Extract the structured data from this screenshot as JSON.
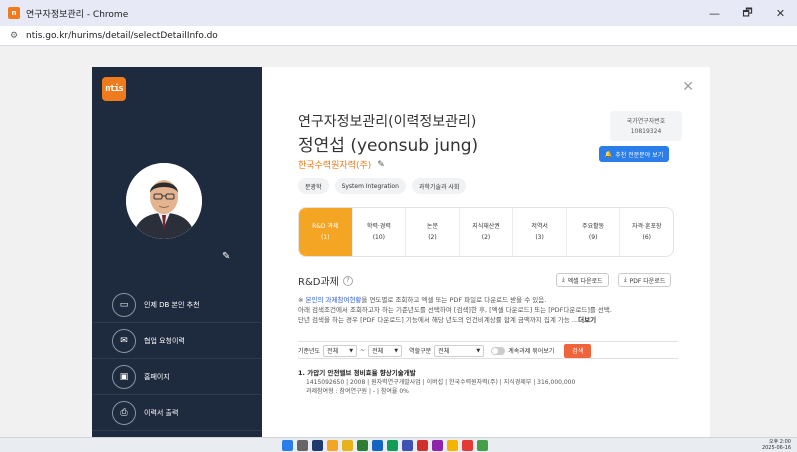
{
  "window": {
    "title": "연구자정보관리 - Chrome",
    "controls": [
      "—",
      "🗗",
      "✕"
    ]
  },
  "address": {
    "url": "ntis.go.kr/hurims/detail/selectDetailInfo.do"
  },
  "sidebar": {
    "logo_text": "ntis",
    "menu": [
      {
        "label": "인제 DB 본인 추천",
        "icon": "id-card-icon"
      },
      {
        "label": "협업 요청이력",
        "icon": "mail-icon"
      },
      {
        "label": "홈페이지",
        "icon": "monitor-icon"
      },
      {
        "label": "이력서 출력",
        "icon": "printer-icon"
      }
    ]
  },
  "profile": {
    "title": "연구자정보관리(이력정보관리)",
    "name": "정연섭 (yeonsub jung)",
    "org": "한국수력원자력(주)",
    "id_label": "국가연구자번호",
    "id_value": "10819324",
    "expert_button": "추천 전문분야 보기",
    "tags": [
      "분광학",
      "System Integration",
      "과학기술과 사회"
    ]
  },
  "tabs": [
    {
      "label": "R&D 과제",
      "count": "(1)",
      "active": true
    },
    {
      "label": "학력·경력",
      "count": "(10)",
      "active": false
    },
    {
      "label": "논문",
      "count": "(2)",
      "active": false
    },
    {
      "label": "지식재산권",
      "count": "(2)",
      "active": false
    },
    {
      "label": "저역서",
      "count": "(3)",
      "active": false
    },
    {
      "label": "주요활동",
      "count": "(9)",
      "active": false
    },
    {
      "label": "자격·훈포장",
      "count": "(6)",
      "active": false
    }
  ],
  "section": {
    "title": "R&D과제",
    "excel_button": "엑셀 다운로드",
    "pdf_button": "PDF 다운로드",
    "notice_prefix": "※ ",
    "notice_highlight": "본인의 과제참여현황",
    "notice_line1_rest": "을 연도별로 조회하고 엑셀 또는 PDF 파일로 다운로드 받을 수 있음.",
    "notice_line2": "아래 검색조건에서 조회하고자 하는 기준년도를 선택하여 [검색]한 후, [엑셀 다운로드] 또는 [PDF다운로드]를 선택.",
    "notice_line3": "단년 검색을 하는 경우 [PDF 다운로드] 기능에서 해당 년도의 인건비계상률 합계 금액까지 집계 가능 ...",
    "notice_more": "더보기"
  },
  "filter": {
    "year_label": "기준년도",
    "year_from": "전체",
    "year_to": "전체",
    "role_label": "역할구분",
    "role_value": "전체",
    "continuing_label": "계속과제 묶어보기",
    "search_button": "검색"
  },
  "results": [
    {
      "title": "1.  가압기 안전밸브 정비효율 향상기술개발",
      "meta": "1415092650 | 2008 | 원자력연구개발사업 | 이버섭 | 한국수력원자력(주) | 지식경제부 | 316,000,000",
      "role": "과제참여형 : 참여연구원 | - | 참여율 0%"
    }
  ],
  "taskbar": {
    "time": "오후 2:00",
    "date": "2025-06-16",
    "app_colors": [
      "#2b7de9",
      "#666666",
      "#1f3b6e",
      "#f5a524",
      "#e8b21a",
      "#2e7d32",
      "#1565c0",
      "#0f9d58",
      "#3f51b5",
      "#d32f2f",
      "#8e24aa",
      "#f4b400",
      "#e53935",
      "#43a047"
    ]
  }
}
